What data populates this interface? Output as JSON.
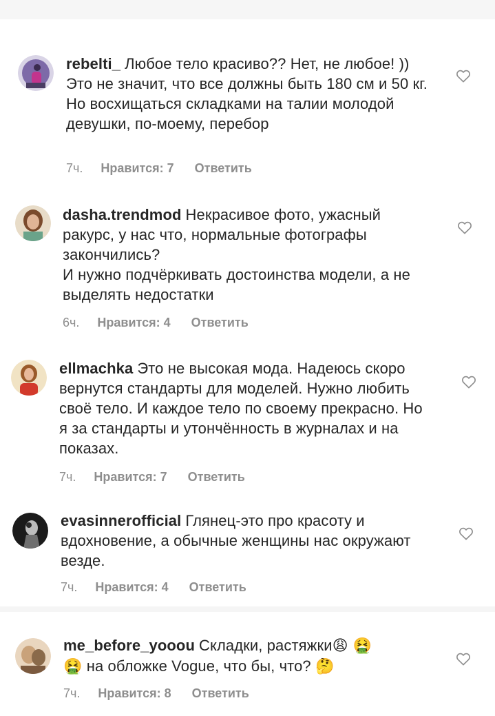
{
  "comments": [
    {
      "username": "rebelti_",
      "text": "Любое тело красиво?? Нет, не любое! )) Это не значит, что все должны быть 180 см и 50 кг. Но восхищаться складками на талии молодой девушки, по-моему, перебор",
      "time": "7ч.",
      "likes": "Нравится: 7",
      "reply": "Ответить"
    },
    {
      "username": "dasha.trendmod",
      "text": "Некрасивое фото, ужасный ракурс, у нас что, нормальные фотографы закончились?",
      "text2": "И нужно подчёркивать достоинства модели, а не выделять недостатки",
      "time": "6ч.",
      "likes": "Нравится: 4",
      "reply": "Ответить"
    },
    {
      "username": "ellmachka",
      "text": "Это не высокая мода. Надеюсь скоро вернутся стандарты для моделей. Нужно любить своё тело. И каждое тело по своему прекрасно. Но я за стандарты и утончённость в журналах и на показах.",
      "time": "7ч.",
      "likes": "Нравится: 7",
      "reply": "Ответить"
    },
    {
      "username": "evasinnerofficial",
      "text": "Глянец-это про красоту и вдохновение, а обычные женщины нас окружают везде.",
      "time": "7ч.",
      "likes": "Нравится: 4",
      "reply": "Ответить"
    },
    {
      "username": "me_before_yooou",
      "text_a": "Складки, растяжки",
      "emoji_a": "😩 🤮",
      "emoji_b": "🤮",
      "text_b": "на обложке Vogue, что бы, что?",
      "emoji_c": "🤔",
      "time": "7ч.",
      "likes": "Нравится: 8",
      "reply": "Ответить"
    }
  ],
  "colors": {
    "text": "#262626",
    "meta": "#8e8e8e",
    "heart": "#8e8e8e"
  },
  "icons": {
    "like": "heart-outline-icon"
  }
}
